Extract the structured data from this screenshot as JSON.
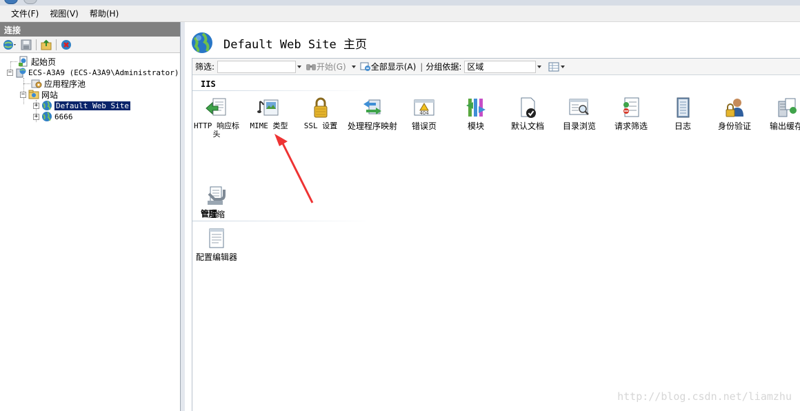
{
  "menu": {
    "items": [
      {
        "label": "文件(F)"
      },
      {
        "label": "视图(V)"
      },
      {
        "label": "帮助(H)"
      }
    ]
  },
  "connections": {
    "title": "连接",
    "tree": {
      "start_page": "起始页",
      "server": "ECS-A3A9 (ECS-A3A9\\Administrator)",
      "app_pools": "应用程序池",
      "sites": "网站",
      "site_default": "Default Web Site",
      "site_6666": "6666"
    }
  },
  "page": {
    "title": "Default Web Site 主页"
  },
  "filterbar": {
    "filter_label": "筛选:",
    "start_label": "开始(G)",
    "show_all_label": "全部显示(A)",
    "group_label": "分组依据:",
    "group_value": "区域"
  },
  "sections": {
    "iis": {
      "title": "IIS",
      "features": [
        {
          "label": "HTTP 响应标头",
          "icon": "http-response-headers-icon"
        },
        {
          "label": "MIME 类型",
          "icon": "mime-types-icon"
        },
        {
          "label": "SSL 设置",
          "icon": "ssl-lock-icon"
        },
        {
          "label": "处理程序映射",
          "icon": "handler-mappings-icon"
        },
        {
          "label": "错误页",
          "icon": "error-pages-icon"
        },
        {
          "label": "模块",
          "icon": "modules-icon"
        },
        {
          "label": "默认文档",
          "icon": "default-document-icon"
        },
        {
          "label": "目录浏览",
          "icon": "directory-browsing-icon"
        },
        {
          "label": "请求筛选",
          "icon": "request-filtering-icon"
        },
        {
          "label": "日志",
          "icon": "logging-icon"
        },
        {
          "label": "身份验证",
          "icon": "authentication-icon"
        },
        {
          "label": "输出缓存",
          "icon": "output-caching-icon"
        },
        {
          "label": "压缩",
          "icon": "compression-icon"
        }
      ]
    },
    "management": {
      "title": "管理",
      "features": [
        {
          "label": "配置编辑器",
          "icon": "configuration-editor-icon"
        }
      ]
    }
  },
  "watermark": "http://blog.csdn.net/liamzhu",
  "colors": {
    "selection": "#0a246a",
    "pane_header": "#808080",
    "annotation_arrow": "#ee3333"
  }
}
